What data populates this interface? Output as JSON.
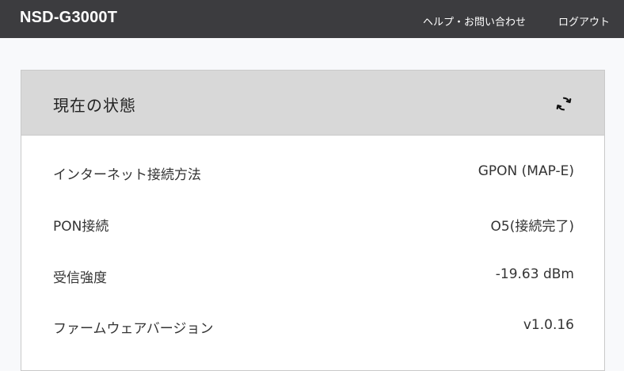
{
  "header": {
    "brand": "NSD-G3000T",
    "help_link": "ヘルプ・お問い合わせ",
    "logout_link": "ログアウト"
  },
  "panel": {
    "title": "現在の状態",
    "refresh_icon": "refresh-icon",
    "rows": [
      {
        "label": "インターネット接続方法",
        "value": "GPON (MAP-E)"
      },
      {
        "label": "PON接続",
        "value": "O5(接続完了)"
      },
      {
        "label": "受信強度",
        "value": "-19.63 dBm"
      },
      {
        "label": "ファームウェアバージョン",
        "value": "v1.0.16"
      }
    ]
  },
  "colors": {
    "topbar": "#3c3c3f",
    "panel_header": "#d8d8d8",
    "background": "#f8f9fb"
  }
}
